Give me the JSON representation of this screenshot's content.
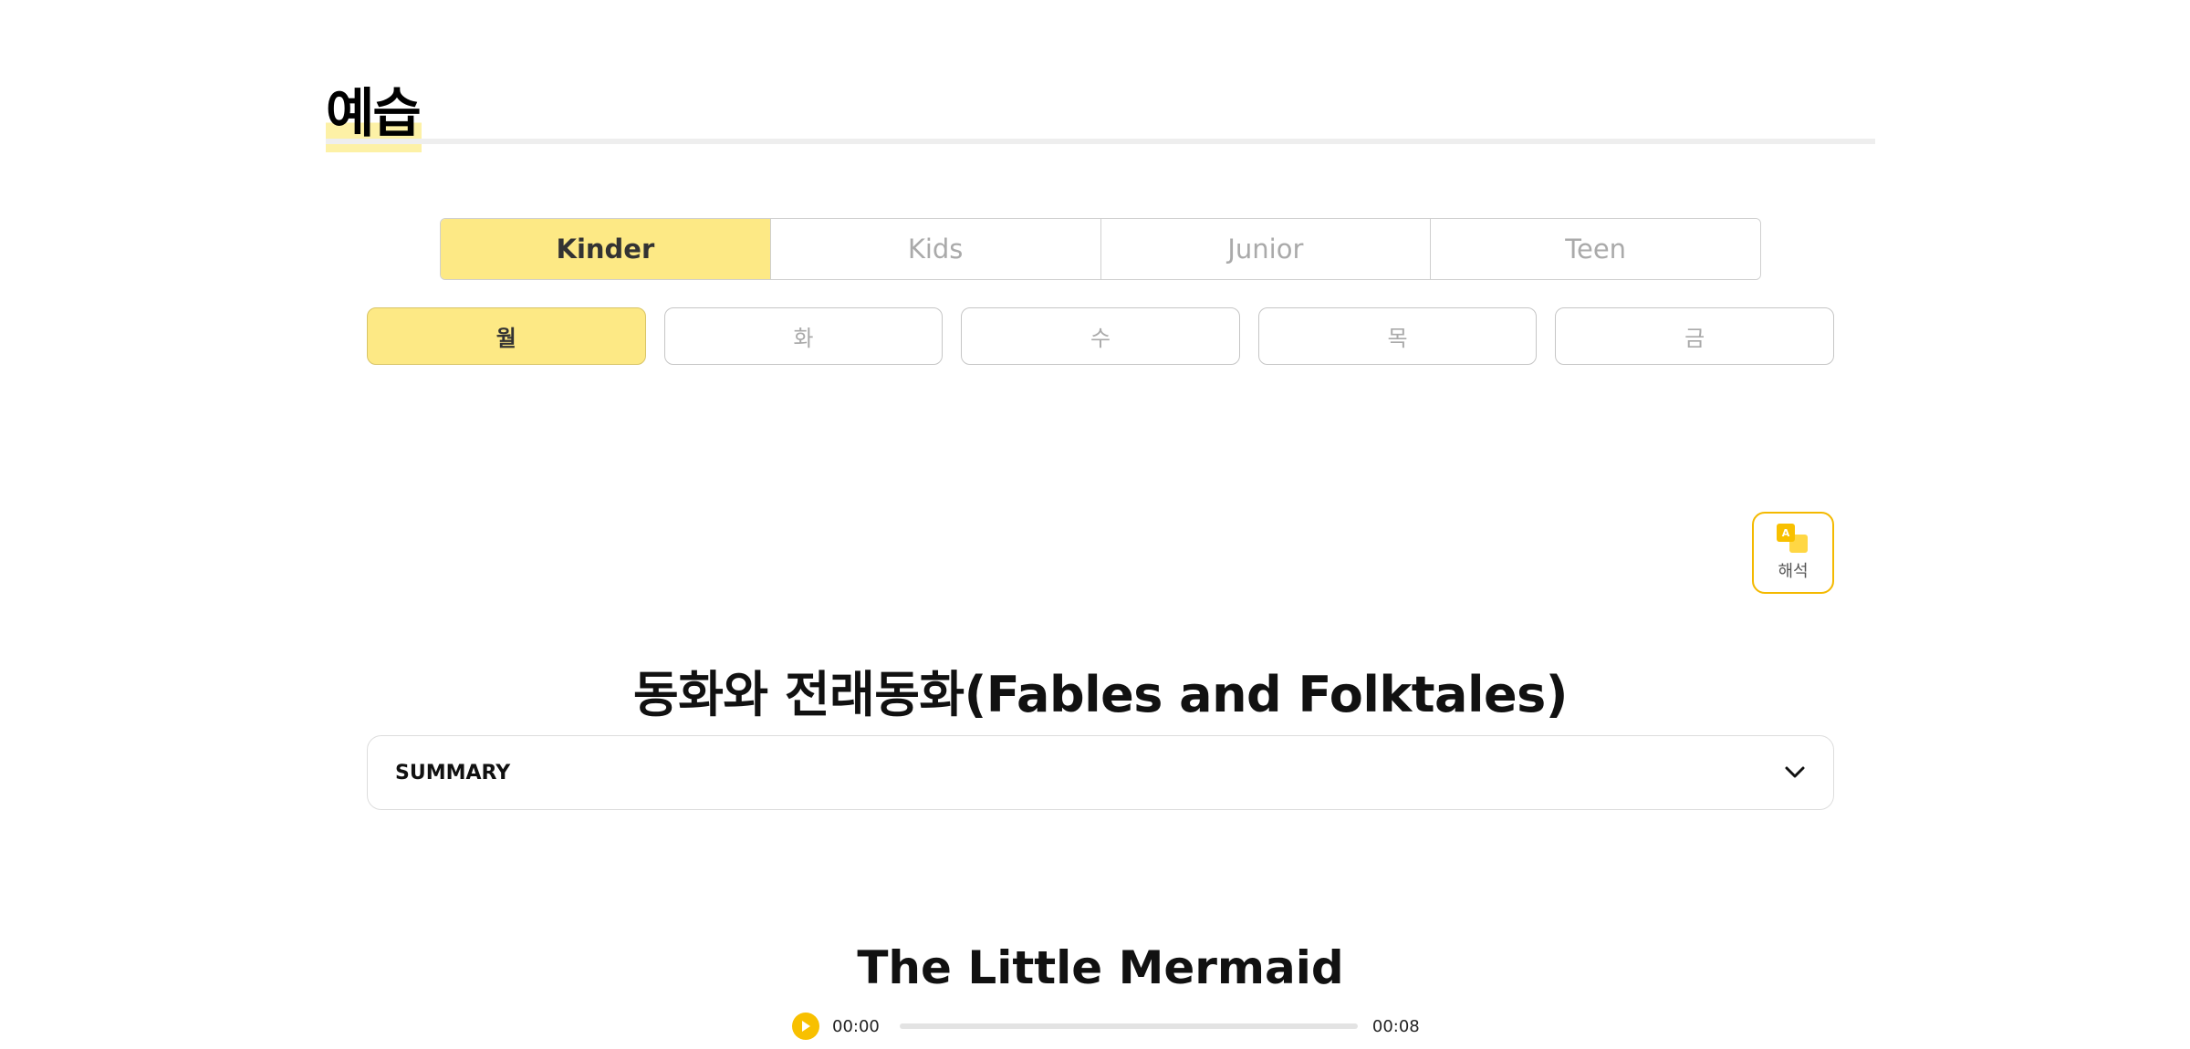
{
  "header": {
    "title": "예습"
  },
  "level_tabs": [
    {
      "label": "Kinder",
      "active": true
    },
    {
      "label": "Kids",
      "active": false
    },
    {
      "label": "Junior",
      "active": false
    },
    {
      "label": "Teen",
      "active": false
    }
  ],
  "day_tabs": [
    {
      "label": "월",
      "active": true
    },
    {
      "label": "화",
      "active": false
    },
    {
      "label": "수",
      "active": false
    },
    {
      "label": "목",
      "active": false
    },
    {
      "label": "금",
      "active": false
    }
  ],
  "translate": {
    "label": "해석",
    "icon": "translate-icon",
    "icon_letter": "A",
    "accent_color": "#f4b900"
  },
  "lesson": {
    "title": "동화와 전래동화(Fables and Folktales)"
  },
  "summary": {
    "label": "SUMMARY",
    "icon": "chevron-down-icon"
  },
  "story": {
    "title": "The Little Mermaid"
  },
  "audio": {
    "current_time": "00:00",
    "duration": "00:08",
    "progress": 0,
    "icon": "play-icon"
  },
  "colors": {
    "active_tab": "#fde985",
    "accent": "#f8c000",
    "inactive_text": "#aaaaaa"
  }
}
